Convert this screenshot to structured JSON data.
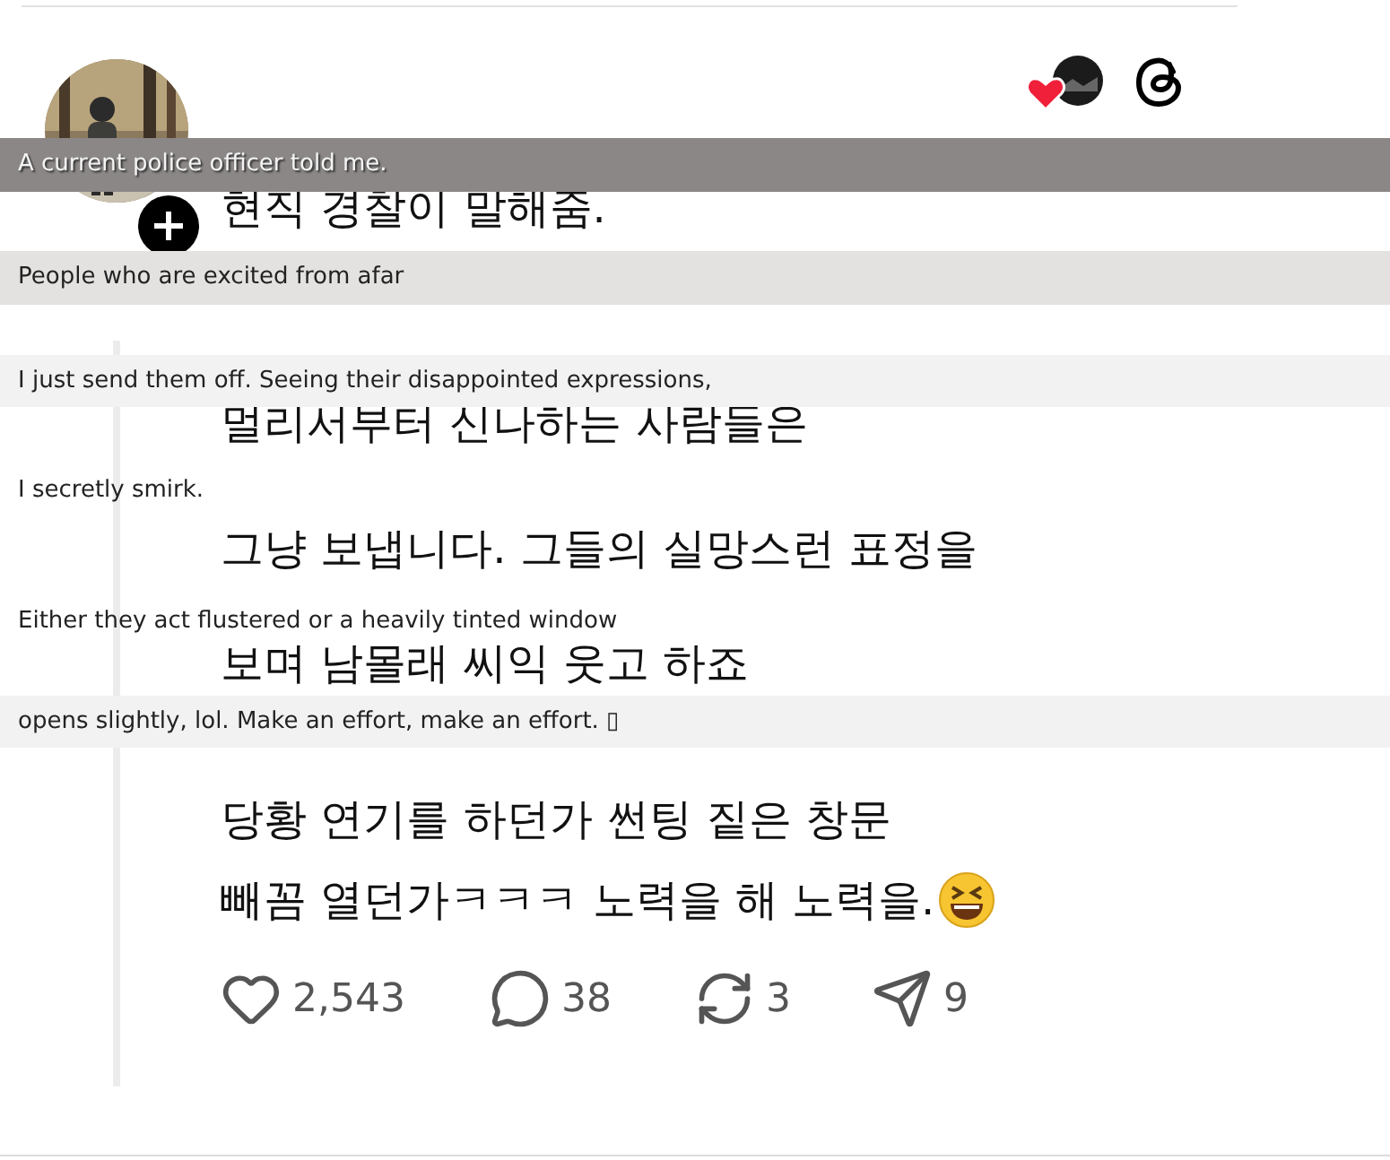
{
  "post": {
    "lines": [
      "현직 경찰이 말해줌.",
      "멀리서부터 신나하는 사람들은",
      "그냥 보냅니다. 그들의 실망스런 표정을",
      "보며 남몰래 씨익 웃고 하죠",
      "당황 연기를 하던가 썬팅 짙은 창문",
      "빼꼼 열던가ㅋㅋㅋ 노력을 해 노력을."
    ],
    "actions": [
      {
        "kind": "like",
        "count": "2,543"
      },
      {
        "kind": "reply",
        "count": "38"
      },
      {
        "kind": "repost",
        "count": "3"
      },
      {
        "kind": "share",
        "count": "9"
      }
    ]
  },
  "translations": [
    {
      "text": "A current police officer told me.",
      "kind": "dark"
    },
    {
      "text": "People who are excited from afar",
      "kind": "gray"
    },
    {
      "text": "I just send them off. Seeing their disappointed expressions,",
      "kind": "light"
    },
    {
      "text": "I secretly smirk.",
      "kind": "plain"
    },
    {
      "text": "Either they act flustered or a heavily tinted window",
      "kind": "plain"
    },
    {
      "text": "opens slightly, lol. Make an effort, make an effort. ▯",
      "kind": "light"
    }
  ]
}
